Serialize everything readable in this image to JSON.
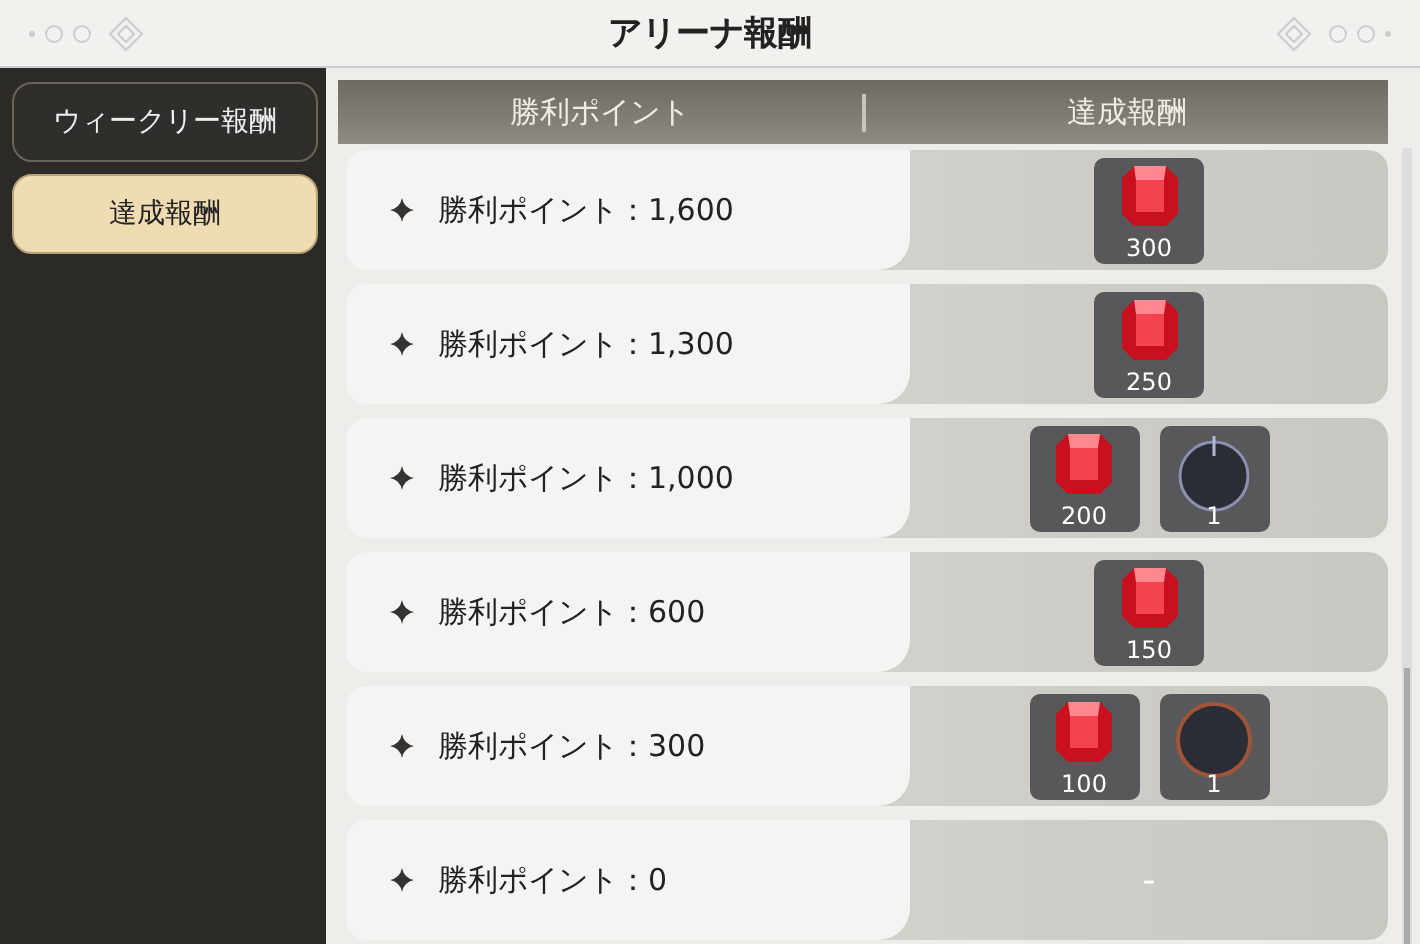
{
  "window": {
    "title": "アリーナ報酬"
  },
  "tabs": [
    {
      "label": "ウィークリー報酬",
      "selected": false
    },
    {
      "label": "達成報酬",
      "selected": true
    }
  ],
  "table": {
    "columns": [
      "勝利ポイント",
      "達成報酬"
    ],
    "rows": [
      {
        "condition": "勝利ポイント：1,600",
        "rewards": [
          {
            "kind": "gem",
            "count": "300"
          }
        ]
      },
      {
        "condition": "勝利ポイント：1,300",
        "rewards": [
          {
            "kind": "gem",
            "count": "250"
          }
        ]
      },
      {
        "condition": "勝利ポイント：1,000",
        "rewards": [
          {
            "kind": "gem",
            "count": "200"
          },
          {
            "kind": "dial",
            "count": "1"
          }
        ]
      },
      {
        "condition": "勝利ポイント：600",
        "rewards": [
          {
            "kind": "gem",
            "count": "150"
          }
        ]
      },
      {
        "condition": "勝利ポイント：300",
        "rewards": [
          {
            "kind": "gem",
            "count": "100"
          },
          {
            "kind": "orb",
            "count": "1"
          }
        ]
      },
      {
        "condition": "勝利ポイント：0",
        "empty_mark": "-"
      }
    ]
  }
}
